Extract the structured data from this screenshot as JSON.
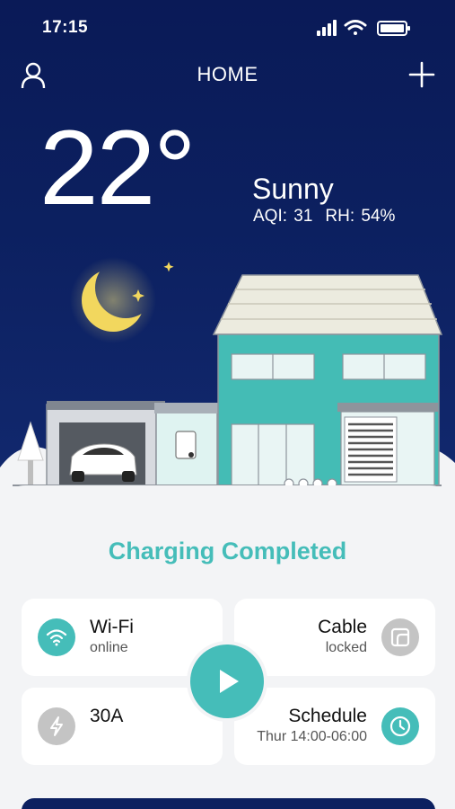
{
  "status_bar": {
    "time": "17:15",
    "signal_icon": "signal-bars-icon",
    "wifi_icon": "wifi-icon",
    "battery_icon": "battery-icon"
  },
  "header": {
    "title": "HOME",
    "left_icon": "user-icon",
    "right_icon": "plus-icon"
  },
  "weather": {
    "temperature": "22°",
    "condition": "Sunny",
    "aqi": "AQI: 31",
    "rh": "RH: 54%"
  },
  "status": {
    "title": "Charging Completed"
  },
  "cards": {
    "wifi": {
      "title": "Wi-Fi",
      "subtitle": "online",
      "icon": "wifi-icon"
    },
    "cable": {
      "title": "Cable",
      "subtitle": "locked",
      "icon": "cable-lock-icon"
    },
    "current": {
      "title": "30A",
      "icon": "lightning-icon"
    },
    "schedule": {
      "title": "Schedule",
      "subtitle": "Thur 14:00-06:00",
      "icon": "clock-icon"
    }
  },
  "play_button": {
    "icon": "play-icon"
  },
  "colors": {
    "accent": "#45bdb9",
    "hero_bg": "#0c2060",
    "panel_bg": "#f3f4f6",
    "muted_icon": "#c4c4c4"
  }
}
